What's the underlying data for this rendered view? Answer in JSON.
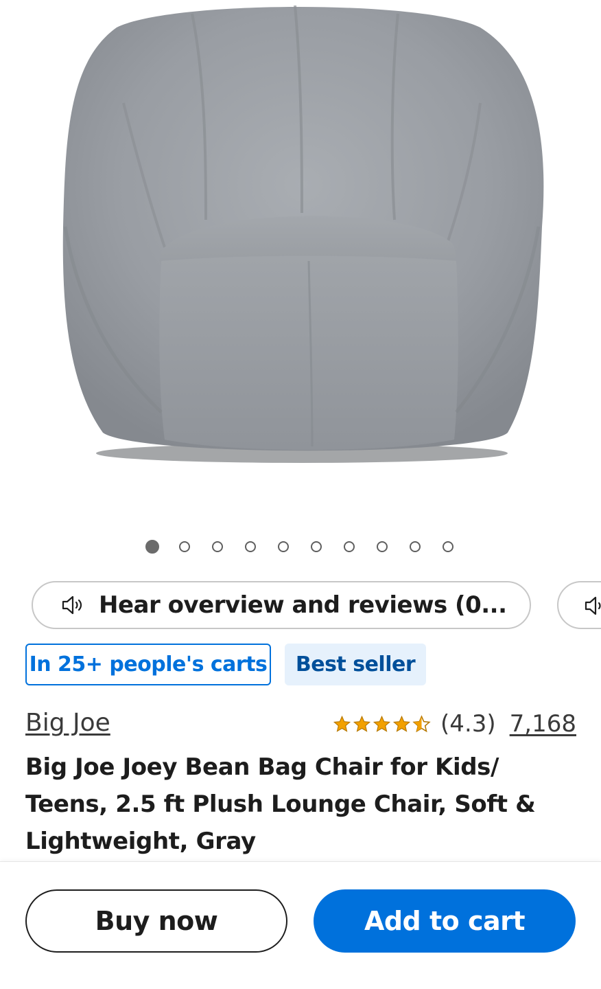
{
  "colors": {
    "accent": "#0071dc",
    "badge_bg": "#e6f1fc",
    "badge_text": "#004f9a",
    "star": "#f2a000",
    "text": "#1d1d1d"
  },
  "image": {
    "alt": "gray-bean-bag-chair",
    "carousel_total": 10,
    "carousel_active_index": 0
  },
  "audio": {
    "label": "Hear overview and reviews (0...",
    "icon": "speaker-icon"
  },
  "badges": {
    "carts": "In 25+ people's carts",
    "best_seller": "Best seller"
  },
  "product": {
    "brand": "Big Joe",
    "rating": 4.3,
    "rating_label": "(4.3)",
    "review_count": "7,168",
    "title": "Big Joe Joey Bean Bag Chair for Kids/ Teens, 2.5 ft Plush Lounge Chair, Soft & Lightweight, Gray"
  },
  "actions": {
    "buy_now": "Buy now",
    "add_to_cart": "Add to cart"
  }
}
